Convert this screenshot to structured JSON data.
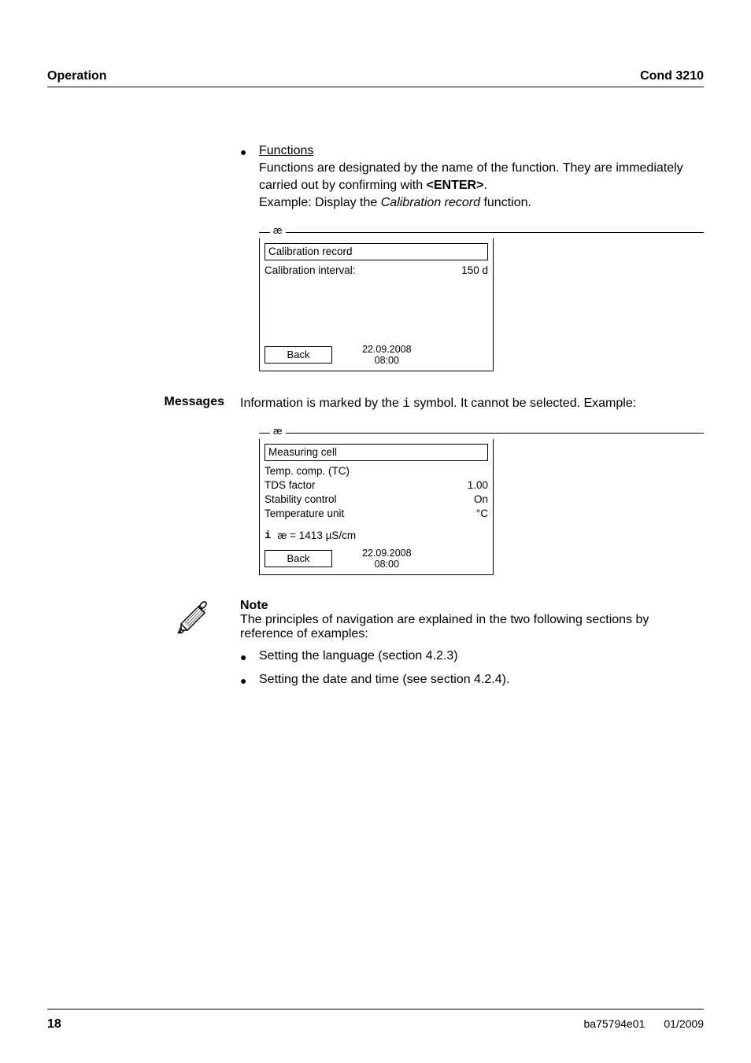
{
  "header": {
    "left": "Operation",
    "right": "Cond 3210"
  },
  "functions": {
    "title": "Functions",
    "body_line1_prefix": "Functions are designated by the name of the function. They are immediately carried out by confirming with ",
    "enter": "<ENTER>",
    "body_line1_suffix": ".",
    "body_line2_prefix": "Example: Display the ",
    "body_line2_italic": "Calibration record",
    "body_line2_suffix": " function."
  },
  "screen1": {
    "tab": "æ",
    "title": "Calibration record",
    "row1_label": "Calibration interval:",
    "row1_value": "150 d",
    "back": "Back",
    "date": "22.09.2008",
    "time": "08:00"
  },
  "messages": {
    "label": "Messages",
    "text_prefix": "Information is marked by the ",
    "i_symbol": "i",
    "text_suffix": " symbol. It cannot be selected. Example:"
  },
  "screen2": {
    "tab": "æ",
    "title": "Measuring cell",
    "rows": [
      {
        "label": "Temp. comp. (TC)",
        "value": ""
      },
      {
        "label": "TDS factor",
        "value": "1.00"
      },
      {
        "label": "Stability control",
        "value": "On"
      },
      {
        "label": "Temperature unit",
        "value": "°C"
      }
    ],
    "info": "æ = 1413 µS/cm",
    "back": "Back",
    "date": "22.09.2008",
    "time": "08:00"
  },
  "note": {
    "label": "Note",
    "body": "The principles of navigation are explained in the two following sections by reference of examples:",
    "bullets": [
      "Setting the language (section 4.2.3)",
      "Setting the date and time (see section 4.2.4)."
    ]
  },
  "footer": {
    "page": "18",
    "doc": "ba75794e01",
    "date": "01/2009"
  }
}
